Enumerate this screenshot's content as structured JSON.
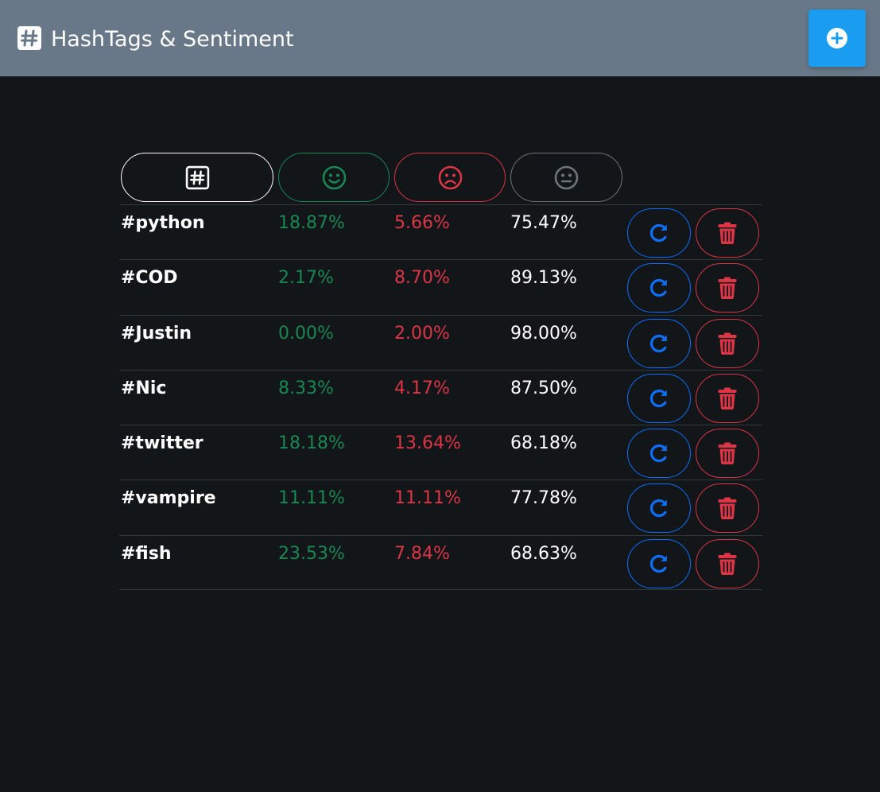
{
  "app": {
    "title": "HashTags & Sentiment",
    "brand_icon": "hashtag-square-icon",
    "add_icon": "plus-circle-icon"
  },
  "colors": {
    "navbar": "#687888",
    "background": "#131619",
    "accent": "#1a9cf0",
    "positive": "#198754",
    "negative": "#dc3545",
    "neutral": "#6c757d",
    "refresh": "#0d6efd"
  },
  "table": {
    "headers": [
      {
        "key": "hashtag",
        "icon": "hashtag-square-icon"
      },
      {
        "key": "positive",
        "icon": "smile-icon"
      },
      {
        "key": "negative",
        "icon": "frown-icon"
      },
      {
        "key": "neutral",
        "icon": "neutral-face-icon"
      }
    ],
    "row_actions": {
      "refresh_icon": "refresh-icon",
      "delete_icon": "trash-icon"
    },
    "rows": [
      {
        "tag": "#python",
        "positive": "18.87%",
        "negative": "5.66%",
        "neutral": "75.47%"
      },
      {
        "tag": "#COD",
        "positive": "2.17%",
        "negative": "8.70%",
        "neutral": "89.13%"
      },
      {
        "tag": "#Justin",
        "positive": "0.00%",
        "negative": "2.00%",
        "neutral": "98.00%"
      },
      {
        "tag": "#Nic",
        "positive": "8.33%",
        "negative": "4.17%",
        "neutral": "87.50%"
      },
      {
        "tag": "#twitter",
        "positive": "18.18%",
        "negative": "13.64%",
        "neutral": "68.18%"
      },
      {
        "tag": "#vampire",
        "positive": "11.11%",
        "negative": "11.11%",
        "neutral": "77.78%"
      },
      {
        "tag": "#fish",
        "positive": "23.53%",
        "negative": "7.84%",
        "neutral": "68.63%"
      }
    ]
  }
}
